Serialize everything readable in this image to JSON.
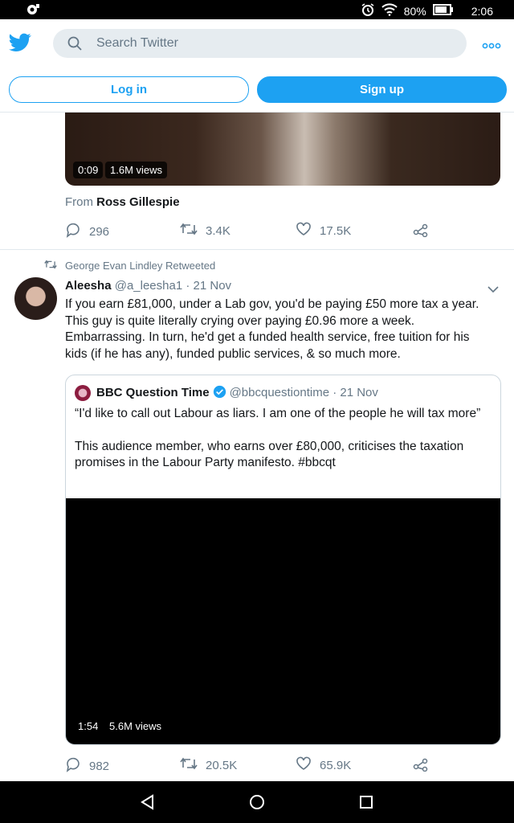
{
  "status_bar": {
    "battery": "80%",
    "time": "2:06"
  },
  "header": {
    "search_placeholder": "Search Twitter",
    "login_label": "Log in",
    "signup_label": "Sign up"
  },
  "tweet1": {
    "video_duration": "0:09",
    "video_views": "1.6M views",
    "from_prefix": "From",
    "from_name": "Ross Gillespie",
    "replies": "296",
    "retweets": "3.4K",
    "likes": "17.5K"
  },
  "tweet2": {
    "retweeted_by": "George Evan Lindley Retweeted",
    "author_name": "Aleesha",
    "author_handle_date": "@a_leesha1 · 21 Nov",
    "text": "If you earn £81,000, under a Lab gov, you'd be paying £50 more tax a year. This guy is quite literally crying over paying £0.96 more a week. Embarrassing. In turn, he'd get a funded health service, free tuition for his kids (if he has any), funded public services, & so much more.",
    "quote": {
      "name": "BBC Question Time",
      "handle_date": "@bbcquestiontime · 21 Nov",
      "text_p1": "“I'd like to call out Labour as liars. I am one of the people he will tax more”",
      "text_p2": "This audience member, who earns over £80,000, criticises the taxation promises in the Labour Party manifesto. #bbcqt",
      "video_duration": "1:54",
      "video_views": "5.6M views"
    },
    "replies": "982",
    "retweets": "20.5K",
    "likes": "65.9K"
  },
  "colors": {
    "accent": "#1da1f2",
    "muted": "#657786",
    "border": "#e1e8ed"
  }
}
